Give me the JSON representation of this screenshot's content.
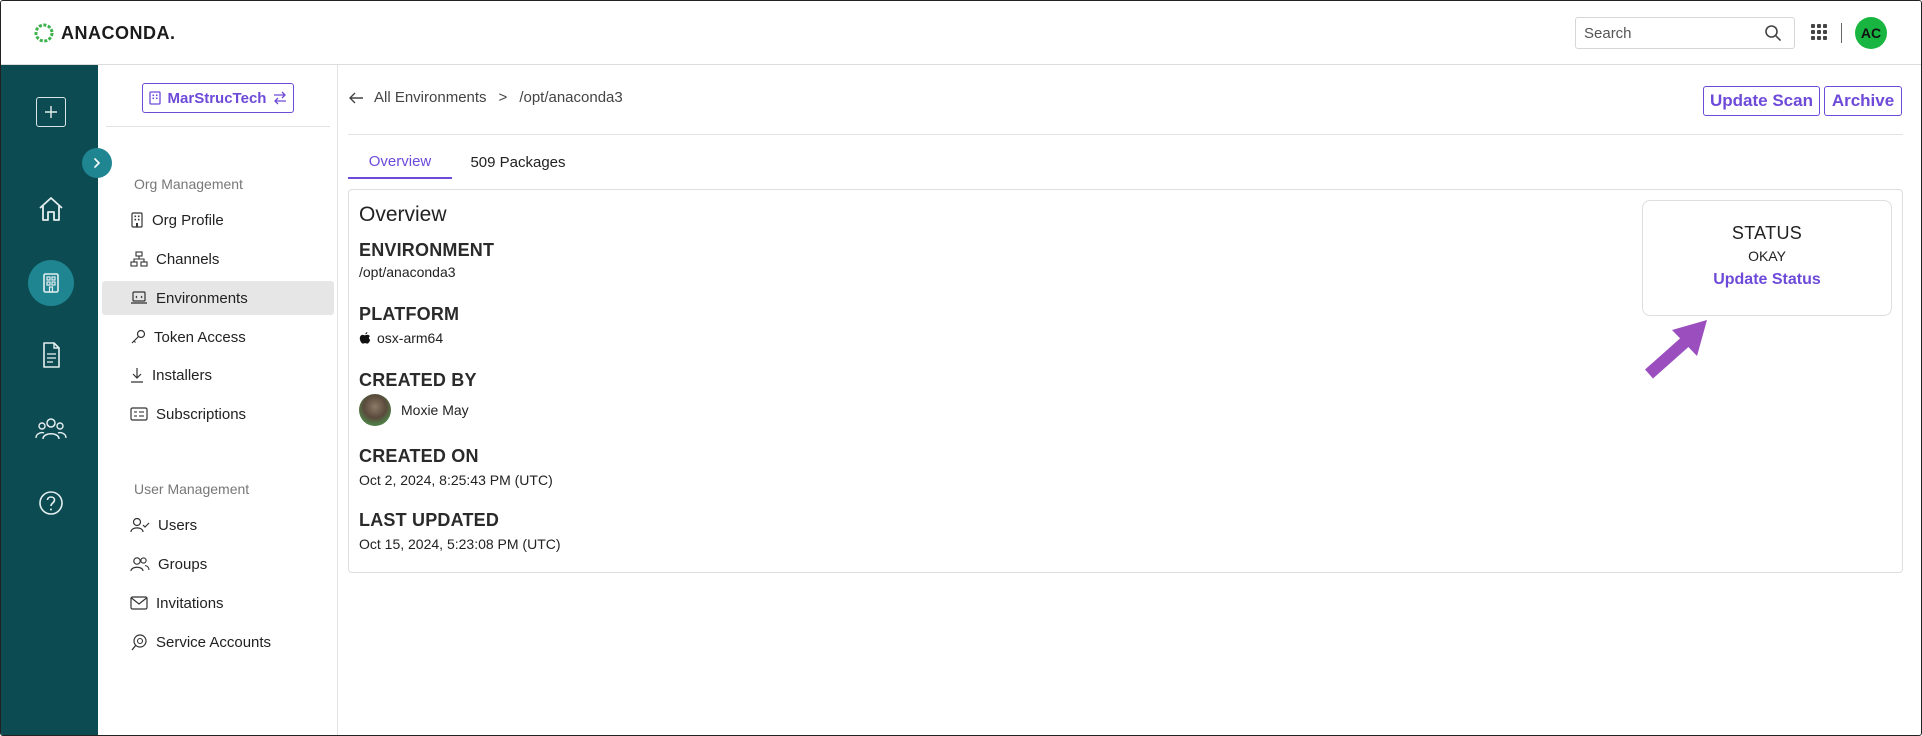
{
  "header": {
    "brand": "ANACONDA.",
    "search_placeholder": "Search",
    "avatar_initials": "AC"
  },
  "colors": {
    "accent": "#6e4ad9",
    "rail": "#0d4b52",
    "rail_active": "#1f8590",
    "avatar": "#18b640",
    "annotation_arrow": "#9b4fbf"
  },
  "rail": {
    "items": [
      {
        "icon": "plus-icon"
      },
      {
        "icon": "home-icon"
      },
      {
        "icon": "building-icon"
      },
      {
        "icon": "document-icon"
      },
      {
        "icon": "people-icon"
      },
      {
        "icon": "help-icon"
      }
    ]
  },
  "sidebar": {
    "org_name": "MarStrucTech",
    "org_section": "Org Management",
    "org_items": [
      {
        "label": "Org Profile",
        "icon": "building-icon"
      },
      {
        "label": "Channels",
        "icon": "channels-icon"
      },
      {
        "label": "Environments",
        "icon": "laptop-icon"
      },
      {
        "label": "Token Access",
        "icon": "key-icon"
      },
      {
        "label": "Installers",
        "icon": "download-icon"
      },
      {
        "label": "Subscriptions",
        "icon": "card-icon"
      }
    ],
    "user_section": "User Management",
    "user_items": [
      {
        "label": "Users",
        "icon": "user-check-icon"
      },
      {
        "label": "Groups",
        "icon": "group-icon"
      },
      {
        "label": "Invitations",
        "icon": "envelope-icon"
      },
      {
        "label": "Service Accounts",
        "icon": "service-icon"
      }
    ]
  },
  "breadcrumb": {
    "parent": "All Environments",
    "separator": ">",
    "current": "/opt/anaconda3"
  },
  "actions": {
    "update_scan": "Update Scan",
    "archive": "Archive"
  },
  "tabs": [
    {
      "label": "Overview"
    },
    {
      "label": "509 Packages"
    }
  ],
  "overview": {
    "title": "Overview",
    "environment_label": "ENVIRONMENT",
    "environment_value": "/opt/anaconda3",
    "platform_label": "PLATFORM",
    "platform_value": "osx-arm64",
    "created_by_label": "CREATED BY",
    "created_by_value": "Moxie May",
    "created_on_label": "CREATED ON",
    "created_on_value": "Oct 2, 2024, 8:25:43 PM (UTC)",
    "last_updated_label": "LAST UPDATED",
    "last_updated_value": "Oct 15, 2024, 5:23:08 PM (UTC)"
  },
  "status": {
    "title": "STATUS",
    "value": "OKAY",
    "link": "Update Status"
  }
}
